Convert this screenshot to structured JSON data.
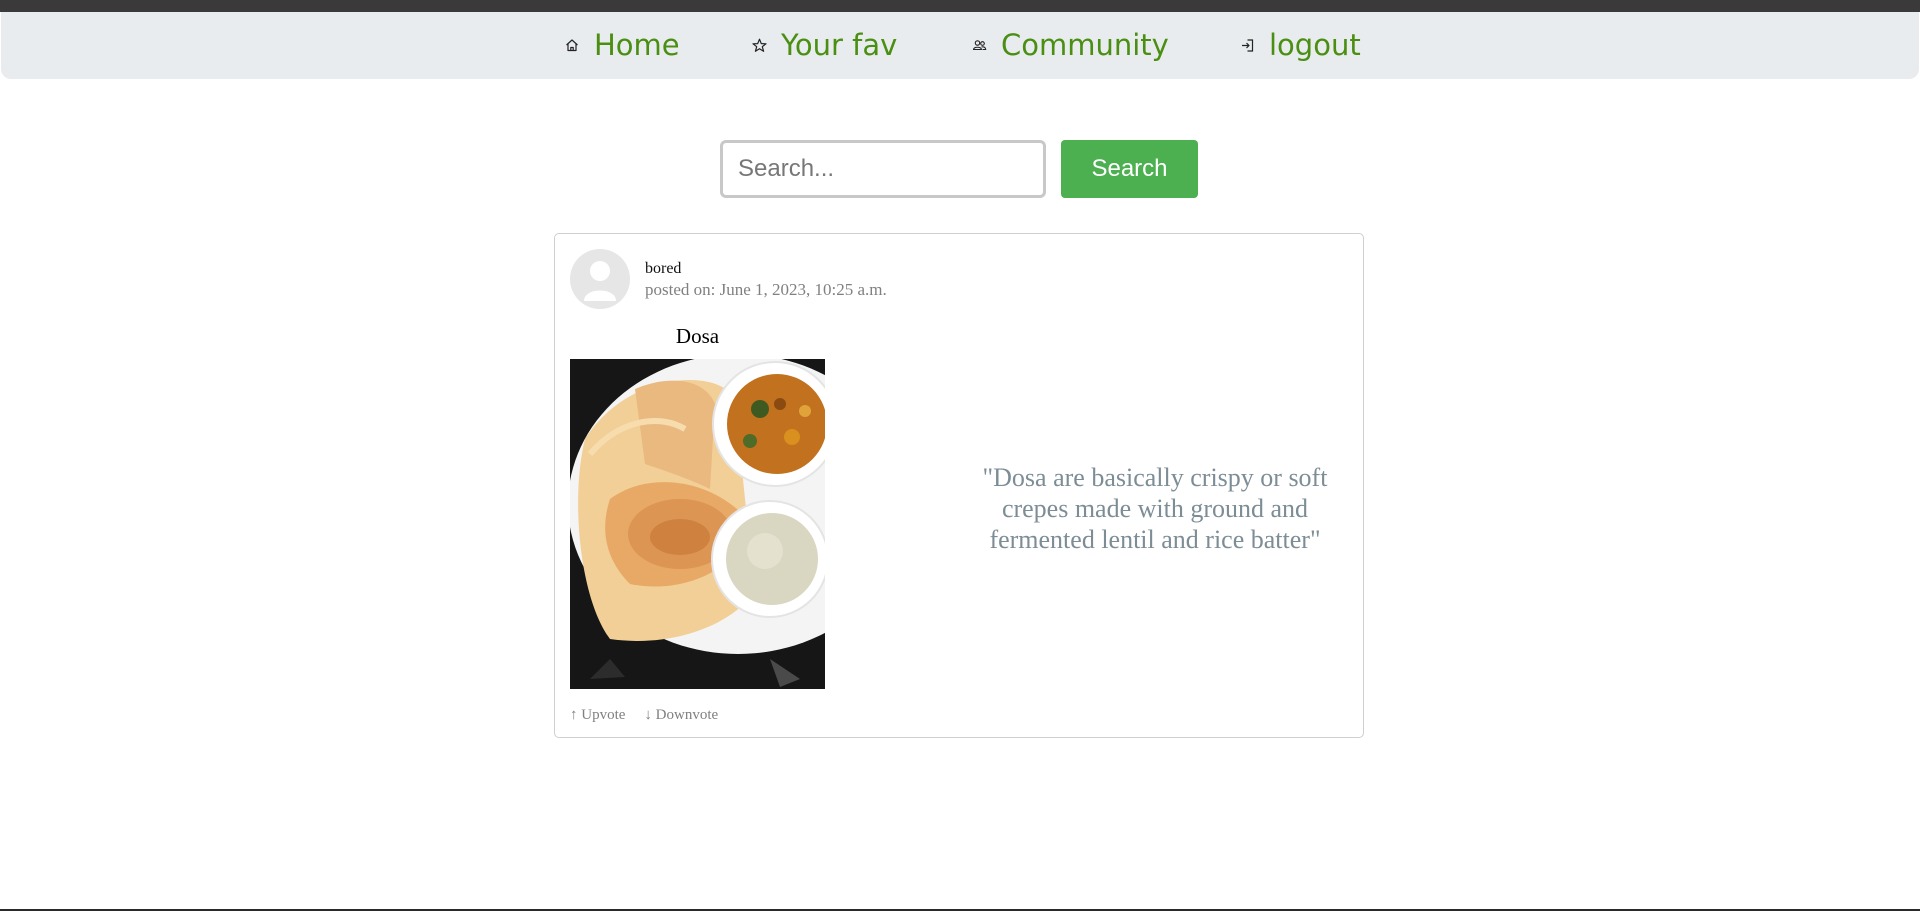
{
  "nav": {
    "items": [
      {
        "label": "Home",
        "icon": "home-icon"
      },
      {
        "label": "Your fav",
        "icon": "star-icon"
      },
      {
        "label": "Community",
        "icon": "people-icon"
      },
      {
        "label": "logout",
        "icon": "logout-icon"
      }
    ],
    "label_color": "#4a8f12"
  },
  "search": {
    "placeholder": "Search...",
    "value": "",
    "button_label": "Search",
    "button_color": "#4caf50"
  },
  "post": {
    "username": "bored",
    "posted_on": "posted on: June 1, 2023, 10:25 a.m.",
    "title": "Dosa",
    "image_alt": "Dosa",
    "quote": "\"Dosa are basically crispy or soft crepes made with ground and fermented lentil and rice batter\"",
    "upvote_label": "↑ Upvote",
    "downvote_label": "↓ Downvote"
  }
}
